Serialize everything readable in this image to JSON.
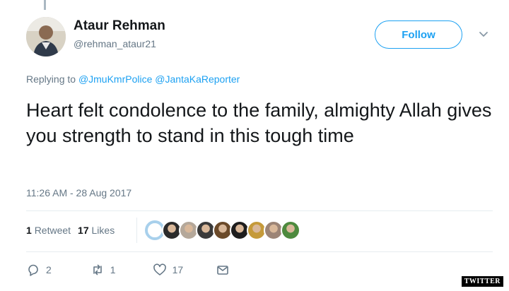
{
  "author": {
    "name": "Ataur Rehman",
    "handle": "@rehman_ataur21"
  },
  "follow_label": "Follow",
  "reply_context": {
    "prefix": "Replying to",
    "mentions": [
      "@JmuKmrPolice",
      "@JantaKaReporter"
    ]
  },
  "tweet_text": "Heart felt condolence to the family, almighty Allah gives you strength to stand in this tough time",
  "timestamp": "11:26 AM - 28 Aug 2017",
  "stats": {
    "retweets_count": "1",
    "retweets_label": "Retweet",
    "likes_count": "17",
    "likes_label": "Likes"
  },
  "likers": [
    {
      "icon": "avatar-blank",
      "color": "#ffffff"
    },
    {
      "icon": "avatar",
      "color": "#2b2b2b"
    },
    {
      "icon": "avatar",
      "color": "#b5a89a"
    },
    {
      "icon": "avatar",
      "color": "#3a3a3a"
    },
    {
      "icon": "avatar",
      "color": "#6b4a2a"
    },
    {
      "icon": "avatar",
      "color": "#1e1e1e"
    },
    {
      "icon": "avatar",
      "color": "#c59a3a"
    },
    {
      "icon": "avatar",
      "color": "#9c8476"
    },
    {
      "icon": "avatar",
      "color": "#4e8a3e"
    }
  ],
  "actions": {
    "replies": "2",
    "retweets": "1",
    "likes": "17"
  },
  "watermark": "TWITTER",
  "colors": {
    "accent": "#1da1f2",
    "muted": "#657786",
    "text": "#14171a"
  }
}
